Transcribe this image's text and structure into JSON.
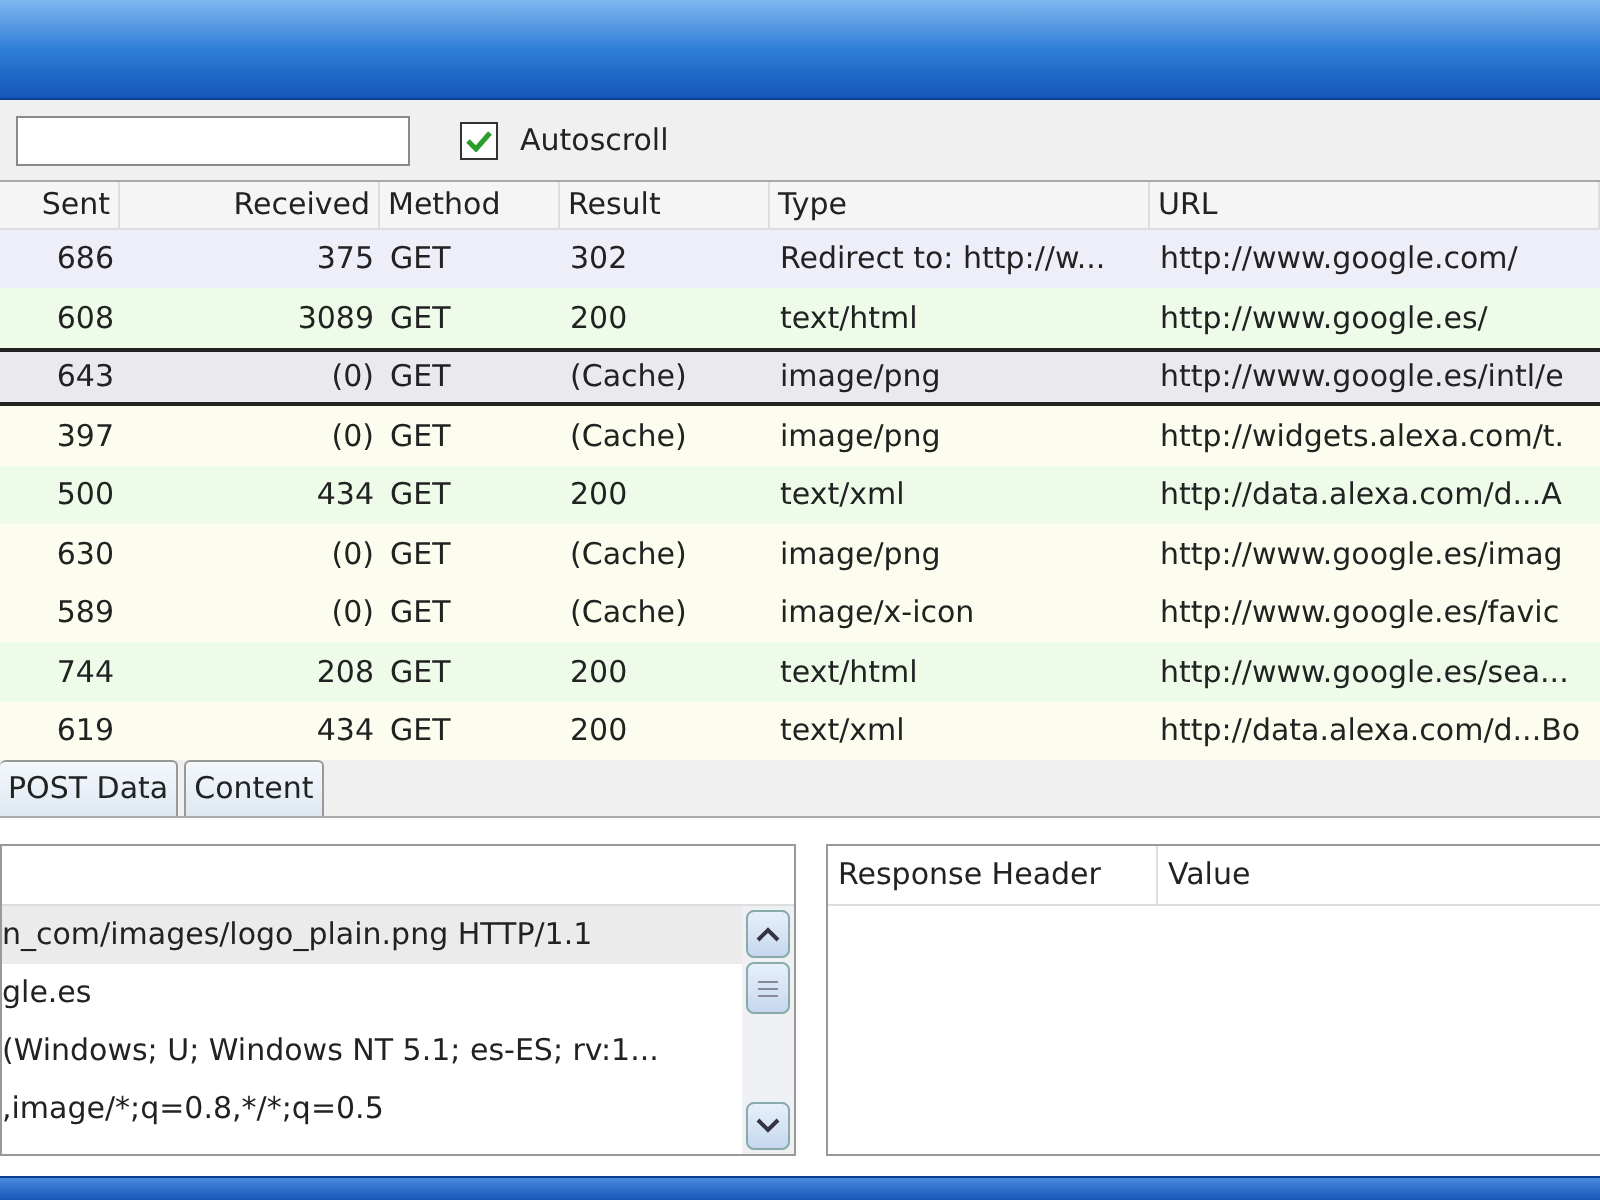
{
  "toolbar": {
    "autoscroll": {
      "label": "Autoscroll",
      "checked": true
    }
  },
  "requests": {
    "columns": [
      "Sent",
      "Received",
      "Method",
      "Result",
      "Type",
      "URL"
    ],
    "rows": [
      {
        "sent": "686",
        "received": "375",
        "method": "GET",
        "result": "302",
        "type": "Redirect to: http://w...",
        "url": "http://www.google.com/",
        "color": "#eeeef9",
        "selected": false
      },
      {
        "sent": "608",
        "received": "3089",
        "method": "GET",
        "result": "200",
        "type": "text/html",
        "url": "http://www.google.es/",
        "color": "#effbe9",
        "selected": false
      },
      {
        "sent": "643",
        "received": "(0)",
        "method": "GET",
        "result": "(Cache)",
        "type": "image/png",
        "url": "http://www.google.es/intl/e",
        "color": "#e9e9ee",
        "selected": true
      },
      {
        "sent": "397",
        "received": "(0)",
        "method": "GET",
        "result": "(Cache)",
        "type": "image/png",
        "url": "http://widgets.alexa.com/t.",
        "color": "#fdfdef",
        "selected": false
      },
      {
        "sent": "500",
        "received": "434",
        "method": "GET",
        "result": "200",
        "type": "text/xml",
        "url": "http://data.alexa.com/d...A",
        "color": "#effbe9",
        "selected": false
      },
      {
        "sent": "630",
        "received": "(0)",
        "method": "GET",
        "result": "(Cache)",
        "type": "image/png",
        "url": "http://www.google.es/imag",
        "color": "#fdfdef",
        "selected": false
      },
      {
        "sent": "589",
        "received": "(0)",
        "method": "GET",
        "result": "(Cache)",
        "type": "image/x-icon",
        "url": "http://www.google.es/favic",
        "color": "#fdfdef",
        "selected": false
      },
      {
        "sent": "744",
        "received": "208",
        "method": "GET",
        "result": "200",
        "type": "text/html",
        "url": "http://www.google.es/sea...",
        "color": "#effbe9",
        "selected": false
      },
      {
        "sent": "619",
        "received": "434",
        "method": "GET",
        "result": "200",
        "type": "text/xml",
        "url": "http://data.alexa.com/d...Bo",
        "color": "#fdfdef",
        "selected": false
      }
    ]
  },
  "detail_tabs": [
    {
      "label": "POST Data"
    },
    {
      "label": "Content"
    }
  ],
  "request_headers": {
    "lines": [
      {
        "text": "n_com/images/logo_plain.png HTTP/1.1",
        "selected": true
      },
      {
        "text": "gle.es",
        "selected": false
      },
      {
        "text": "(Windows; U; Windows NT 5.1; es-ES; rv:1...",
        "selected": false
      },
      {
        "text": ",image/*;q=0.8,*/*;q=0.5",
        "selected": false
      }
    ]
  },
  "response_headers": {
    "columns": [
      "Response Header",
      "Value"
    ]
  }
}
